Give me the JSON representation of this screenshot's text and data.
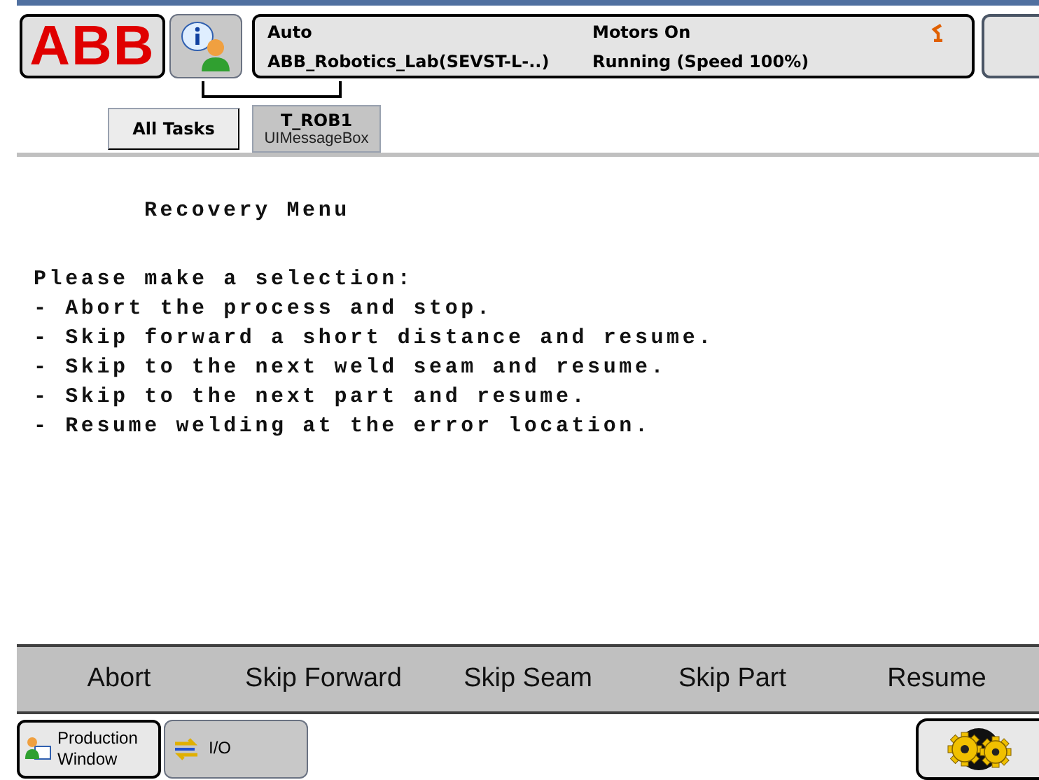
{
  "header": {
    "logo": "ABB",
    "status": {
      "mode": "Auto",
      "system": "ABB_Robotics_Lab(SEVST-L-..)",
      "motors": "Motors On",
      "program": "Running (Speed 100%)"
    }
  },
  "tabs": [
    {
      "label": "All Tasks",
      "selected": false
    },
    {
      "label": "T_ROB1",
      "sublabel": "UIMessageBox",
      "selected": true
    }
  ],
  "message": {
    "title": "Recovery Menu",
    "lines": [
      "Please make a selection:",
      "- Abort the process and stop.",
      "- Skip forward a short distance and resume.",
      "- Skip to the next weld seam and resume.",
      "- Skip to the next part and resume.",
      "- Resume welding at the error location."
    ]
  },
  "buttons": [
    "Abort",
    "Skip Forward",
    "Skip Seam",
    "Skip Part",
    "Resume"
  ],
  "taskbar": [
    {
      "label": "Production Window",
      "kind": "production"
    },
    {
      "label": "I/O",
      "kind": "io"
    }
  ]
}
